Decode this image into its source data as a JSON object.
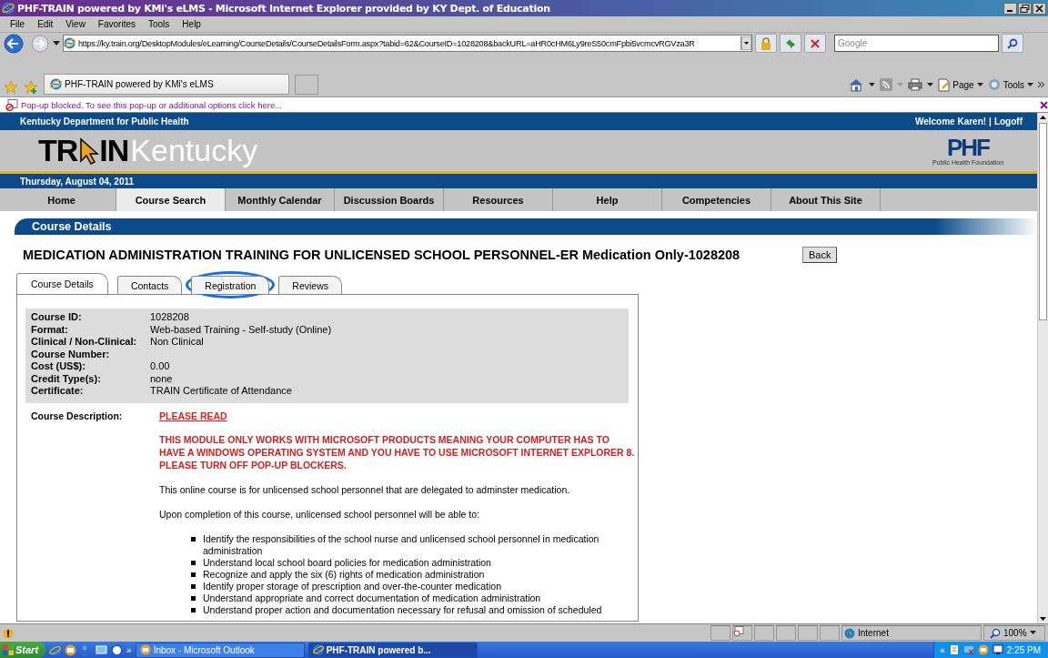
{
  "window": {
    "title": "PHF-TRAIN powered by KMi's eLMS - Microsoft Internet Explorer provided by KY Dept. of Education"
  },
  "menu": [
    "File",
    "Edit",
    "View",
    "Favorites",
    "Tools",
    "Help"
  ],
  "address": {
    "value": "https://ky.train.org/DesktopModules/eLearning/CourseDetails/CourseDetailsForm.aspx?tabid=62&CourseID=1028208&backURL=aHR0cHM6Ly9reS50cmFpbi5vcmcvRGVza3R"
  },
  "search": {
    "placeholder": "Google"
  },
  "browser_tab": {
    "title": "PHF-TRAIN powered by KMi's eLMS"
  },
  "command_bar": [
    "Page",
    "Tools"
  ],
  "info_bar": {
    "text": "Pop-up blocked. To see this pop-up or additional options click here..."
  },
  "site": {
    "organization": "Kentucky Department for Public Health",
    "welcome": "Welcome Karen!",
    "separator": "|",
    "logoff": "Logoff",
    "logo": {
      "left": "TR",
      "right": "IN",
      "suffix": "Kentucky"
    },
    "partner_logo": {
      "name": "PHF",
      "tagline": "Public Health Foundation"
    },
    "date": "Thursday, August 04, 2011"
  },
  "nav": [
    {
      "label": "Home",
      "selected": false
    },
    {
      "label": "Course Search",
      "selected": true
    },
    {
      "label": "Monthly Calendar",
      "selected": false
    },
    {
      "label": "Discussion Boards",
      "selected": false
    },
    {
      "label": "Resources",
      "selected": false
    },
    {
      "label": "Help",
      "selected": false
    },
    {
      "label": "Competencies",
      "selected": false
    },
    {
      "label": "About This Site",
      "selected": false
    }
  ],
  "section_heading": "Course Details",
  "course_title": "MEDICATION ADMINISTRATION TRAINING FOR UNLICENSED SCHOOL PERSONNEL-ER Medication Only-1028208",
  "back_button": "Back",
  "tabs": [
    {
      "label": "Course Details",
      "selected": true
    },
    {
      "label": "Contacts",
      "selected": false
    },
    {
      "label": "Registration",
      "selected": false
    },
    {
      "label": "Reviews",
      "selected": false
    }
  ],
  "fields": [
    {
      "label": "Course ID:",
      "value": "1028208"
    },
    {
      "label": "Format:",
      "value": "Web-based Training - Self-study (Online)"
    },
    {
      "label": "Clinical / Non-Clinical:",
      "value": "Non Clinical"
    },
    {
      "label": "Course Number:"
    },
    {
      "label": "Cost (US$):",
      "value": "0.00"
    },
    {
      "label": "Credit Type(s):",
      "value": "none"
    },
    {
      "label": "Certificate:",
      "value": "TRAIN Certificate of Attendance"
    }
  ],
  "description": {
    "label": "Course Description:",
    "link": "PLEASE READ",
    "warning": "THIS MODULE ONLY WORKS WITH MICROSOFT PRODUCTS MEANING YOUR COMPUTER HAS TO HAVE A WINDOWS OPERATING SYSTEM AND YOU HAVE TO USE MICROSOFT INTERNET EXPLORER 8.  PLEASE TURN OFF POP-UP BLOCKERS.",
    "paragraphs": [
      "This online course is for unlicensed school personnel that are delegated to adminster medication.",
      "Upon completion of this course, unlicensed school personnel will be able to:"
    ],
    "bullets": [
      "Identify the responsibilities of the school nurse and unlicensed school personnel in medication administration",
      "Understand local school board policies for medication administration",
      "Recognize and apply the six (6) rights of medication administration",
      "Identify proper storage of prescription and over-the-counter medication",
      "Understand appropriate and correct documentation of medication administration",
      "Understand proper action and documentation necessary for refusal and omission of scheduled"
    ]
  },
  "status_bar": {
    "zone": "Internet",
    "zoom": "100%"
  },
  "taskbar": {
    "start": "Start",
    "overflow": "»",
    "tasks": [
      {
        "label": "Inbox - Microsoft Outlook",
        "selected": false
      },
      {
        "label": "PHF-TRAIN powered b...",
        "selected": true
      }
    ],
    "tray_toggle": "«",
    "clock": "2:25 PM"
  }
}
